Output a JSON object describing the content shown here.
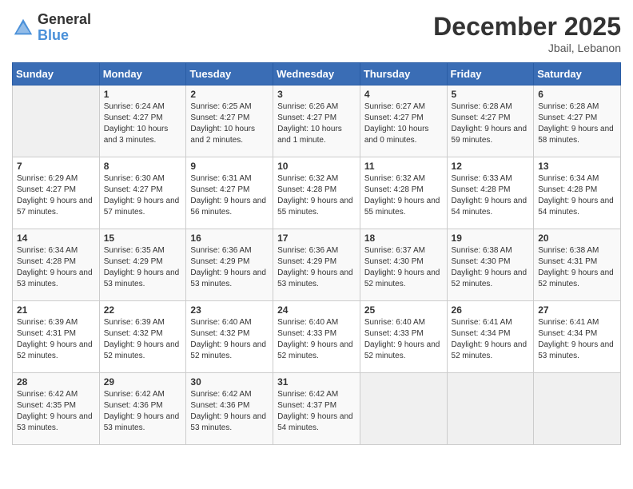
{
  "logo": {
    "general": "General",
    "blue": "Blue"
  },
  "header": {
    "month": "December 2025",
    "location": "Jbail, Lebanon"
  },
  "weekdays": [
    "Sunday",
    "Monday",
    "Tuesday",
    "Wednesday",
    "Thursday",
    "Friday",
    "Saturday"
  ],
  "weeks": [
    [
      {
        "day": "",
        "sunrise": "",
        "sunset": "",
        "daylight": ""
      },
      {
        "day": "1",
        "sunrise": "Sunrise: 6:24 AM",
        "sunset": "Sunset: 4:27 PM",
        "daylight": "Daylight: 10 hours and 3 minutes."
      },
      {
        "day": "2",
        "sunrise": "Sunrise: 6:25 AM",
        "sunset": "Sunset: 4:27 PM",
        "daylight": "Daylight: 10 hours and 2 minutes."
      },
      {
        "day": "3",
        "sunrise": "Sunrise: 6:26 AM",
        "sunset": "Sunset: 4:27 PM",
        "daylight": "Daylight: 10 hours and 1 minute."
      },
      {
        "day": "4",
        "sunrise": "Sunrise: 6:27 AM",
        "sunset": "Sunset: 4:27 PM",
        "daylight": "Daylight: 10 hours and 0 minutes."
      },
      {
        "day": "5",
        "sunrise": "Sunrise: 6:28 AM",
        "sunset": "Sunset: 4:27 PM",
        "daylight": "Daylight: 9 hours and 59 minutes."
      },
      {
        "day": "6",
        "sunrise": "Sunrise: 6:28 AM",
        "sunset": "Sunset: 4:27 PM",
        "daylight": "Daylight: 9 hours and 58 minutes."
      }
    ],
    [
      {
        "day": "7",
        "sunrise": "Sunrise: 6:29 AM",
        "sunset": "Sunset: 4:27 PM",
        "daylight": "Daylight: 9 hours and 57 minutes."
      },
      {
        "day": "8",
        "sunrise": "Sunrise: 6:30 AM",
        "sunset": "Sunset: 4:27 PM",
        "daylight": "Daylight: 9 hours and 57 minutes."
      },
      {
        "day": "9",
        "sunrise": "Sunrise: 6:31 AM",
        "sunset": "Sunset: 4:27 PM",
        "daylight": "Daylight: 9 hours and 56 minutes."
      },
      {
        "day": "10",
        "sunrise": "Sunrise: 6:32 AM",
        "sunset": "Sunset: 4:28 PM",
        "daylight": "Daylight: 9 hours and 55 minutes."
      },
      {
        "day": "11",
        "sunrise": "Sunrise: 6:32 AM",
        "sunset": "Sunset: 4:28 PM",
        "daylight": "Daylight: 9 hours and 55 minutes."
      },
      {
        "day": "12",
        "sunrise": "Sunrise: 6:33 AM",
        "sunset": "Sunset: 4:28 PM",
        "daylight": "Daylight: 9 hours and 54 minutes."
      },
      {
        "day": "13",
        "sunrise": "Sunrise: 6:34 AM",
        "sunset": "Sunset: 4:28 PM",
        "daylight": "Daylight: 9 hours and 54 minutes."
      }
    ],
    [
      {
        "day": "14",
        "sunrise": "Sunrise: 6:34 AM",
        "sunset": "Sunset: 4:28 PM",
        "daylight": "Daylight: 9 hours and 53 minutes."
      },
      {
        "day": "15",
        "sunrise": "Sunrise: 6:35 AM",
        "sunset": "Sunset: 4:29 PM",
        "daylight": "Daylight: 9 hours and 53 minutes."
      },
      {
        "day": "16",
        "sunrise": "Sunrise: 6:36 AM",
        "sunset": "Sunset: 4:29 PM",
        "daylight": "Daylight: 9 hours and 53 minutes."
      },
      {
        "day": "17",
        "sunrise": "Sunrise: 6:36 AM",
        "sunset": "Sunset: 4:29 PM",
        "daylight": "Daylight: 9 hours and 53 minutes."
      },
      {
        "day": "18",
        "sunrise": "Sunrise: 6:37 AM",
        "sunset": "Sunset: 4:30 PM",
        "daylight": "Daylight: 9 hours and 52 minutes."
      },
      {
        "day": "19",
        "sunrise": "Sunrise: 6:38 AM",
        "sunset": "Sunset: 4:30 PM",
        "daylight": "Daylight: 9 hours and 52 minutes."
      },
      {
        "day": "20",
        "sunrise": "Sunrise: 6:38 AM",
        "sunset": "Sunset: 4:31 PM",
        "daylight": "Daylight: 9 hours and 52 minutes."
      }
    ],
    [
      {
        "day": "21",
        "sunrise": "Sunrise: 6:39 AM",
        "sunset": "Sunset: 4:31 PM",
        "daylight": "Daylight: 9 hours and 52 minutes."
      },
      {
        "day": "22",
        "sunrise": "Sunrise: 6:39 AM",
        "sunset": "Sunset: 4:32 PM",
        "daylight": "Daylight: 9 hours and 52 minutes."
      },
      {
        "day": "23",
        "sunrise": "Sunrise: 6:40 AM",
        "sunset": "Sunset: 4:32 PM",
        "daylight": "Daylight: 9 hours and 52 minutes."
      },
      {
        "day": "24",
        "sunrise": "Sunrise: 6:40 AM",
        "sunset": "Sunset: 4:33 PM",
        "daylight": "Daylight: 9 hours and 52 minutes."
      },
      {
        "day": "25",
        "sunrise": "Sunrise: 6:40 AM",
        "sunset": "Sunset: 4:33 PM",
        "daylight": "Daylight: 9 hours and 52 minutes."
      },
      {
        "day": "26",
        "sunrise": "Sunrise: 6:41 AM",
        "sunset": "Sunset: 4:34 PM",
        "daylight": "Daylight: 9 hours and 52 minutes."
      },
      {
        "day": "27",
        "sunrise": "Sunrise: 6:41 AM",
        "sunset": "Sunset: 4:34 PM",
        "daylight": "Daylight: 9 hours and 53 minutes."
      }
    ],
    [
      {
        "day": "28",
        "sunrise": "Sunrise: 6:42 AM",
        "sunset": "Sunset: 4:35 PM",
        "daylight": "Daylight: 9 hours and 53 minutes."
      },
      {
        "day": "29",
        "sunrise": "Sunrise: 6:42 AM",
        "sunset": "Sunset: 4:36 PM",
        "daylight": "Daylight: 9 hours and 53 minutes."
      },
      {
        "day": "30",
        "sunrise": "Sunrise: 6:42 AM",
        "sunset": "Sunset: 4:36 PM",
        "daylight": "Daylight: 9 hours and 53 minutes."
      },
      {
        "day": "31",
        "sunrise": "Sunrise: 6:42 AM",
        "sunset": "Sunset: 4:37 PM",
        "daylight": "Daylight: 9 hours and 54 minutes."
      },
      {
        "day": "",
        "sunrise": "",
        "sunset": "",
        "daylight": ""
      },
      {
        "day": "",
        "sunrise": "",
        "sunset": "",
        "daylight": ""
      },
      {
        "day": "",
        "sunrise": "",
        "sunset": "",
        "daylight": ""
      }
    ]
  ]
}
